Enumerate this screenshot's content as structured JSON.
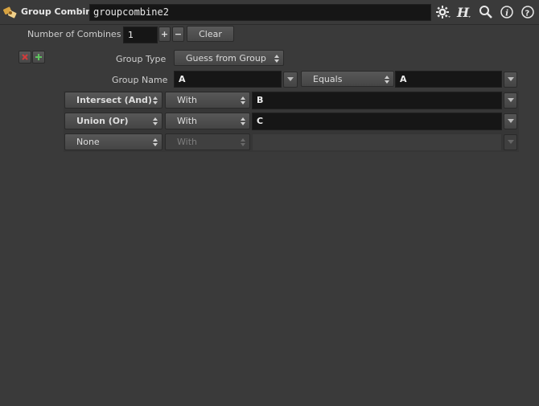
{
  "header": {
    "node_type": "Group Combine",
    "node_name": "groupcombine2"
  },
  "params": {
    "num_combines_label": "Number of Combines",
    "num_combines_value": "1",
    "plus_label": "+",
    "minus_label": "−",
    "clear_label": "Clear",
    "group_type_label": "Group Type",
    "group_type_value": "Guess from Group",
    "group_name_label": "Group Name",
    "group_name_value": "A",
    "equals_value": "Equals",
    "equals_target": "A"
  },
  "rows": [
    {
      "op": "Intersect (And)",
      "with": "With",
      "group": "B"
    },
    {
      "op": "Union (Or)",
      "with": "With",
      "group": "C"
    },
    {
      "op": "None",
      "with": "With",
      "group": ""
    }
  ],
  "colors": {
    "background": "#3a3a3a",
    "field": "#161616",
    "remove_red": "#d23b3b",
    "add_green": "#5fc35f"
  }
}
